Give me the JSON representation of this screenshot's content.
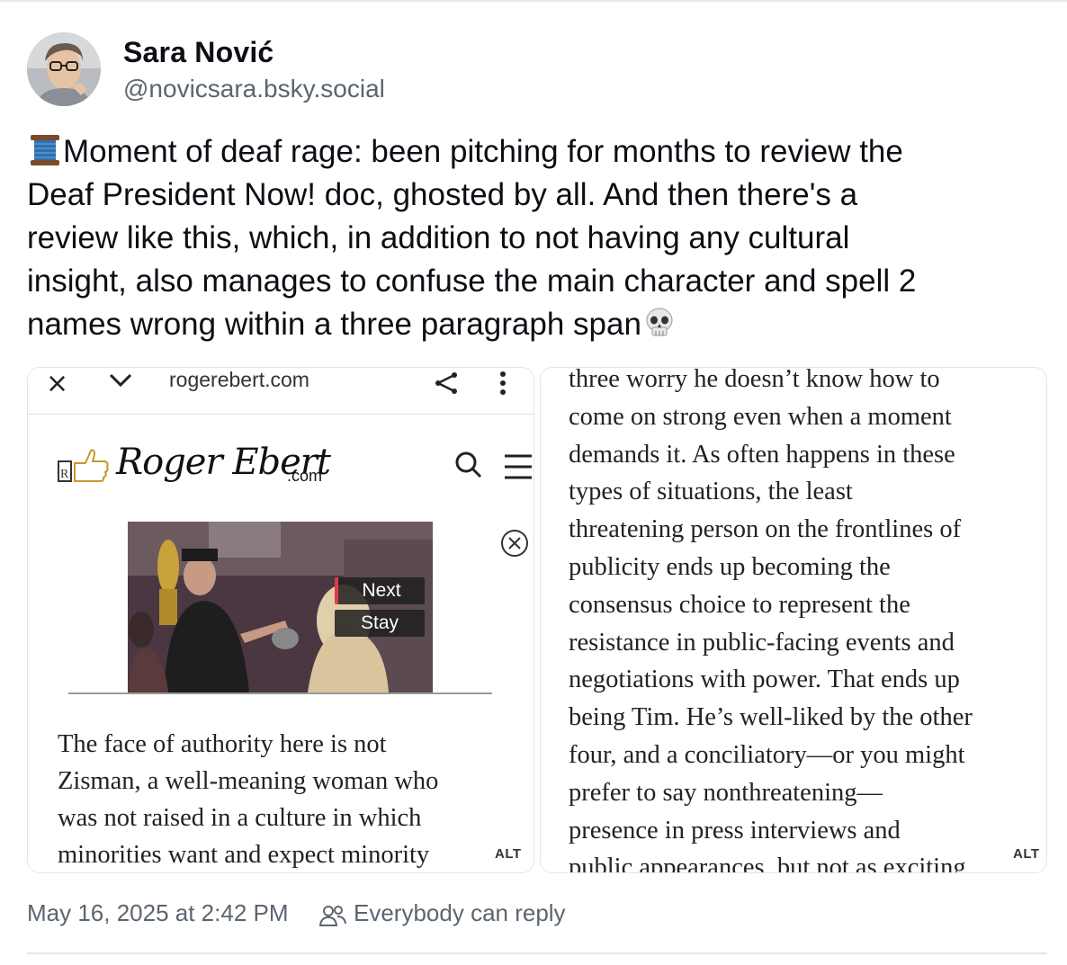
{
  "author": {
    "display_name": "Sara Nović",
    "handle": "@novicsara.bsky.social",
    "avatar_icon": "avatar"
  },
  "post": {
    "lines": [
      "Moment of deaf rage: been pitching for months to review the",
      "Deaf President Now! doc, ghosted by all. And then there's a",
      "review like this, which, in addition to not having any cultural",
      "insight, also manages to confuse the main character and spell 2",
      "names wrong within a three paragraph span"
    ],
    "lead_emoji": "spool-of-thread-icon",
    "trail_emoji": "skull-icon"
  },
  "images": {
    "left": {
      "browser": {
        "close_glyph": "×",
        "url": "rogerebert.com"
      },
      "site": {
        "logo_script": "Roger Ebert",
        "logo_com": ".com"
      },
      "video": {
        "next_label": "Next",
        "stay_label": "Stay"
      },
      "article_lines": [
        "The face of authority here is not",
        "Zisman, a well-meaning woman who",
        "was not raised in a culture in which",
        "minorities want and expect minority"
      ],
      "alt_label": "ALT"
    },
    "right": {
      "article_lines": [
        "three worry he doesn’t know how to",
        "come on strong even when a moment",
        "demands it. As often happens in these",
        "types of situations, the least",
        "threatening person on the frontlines of",
        "publicity ends up becoming the",
        "consensus choice to represent the",
        "resistance in public-facing events and",
        "negotiations with power. That ends up",
        "being Tim. He’s well-liked by the other",
        "four, and a conciliatory—or you might",
        "prefer to say nonthreatening—",
        "presence in press interviews and",
        "public appearances, but not as exciting"
      ],
      "alt_label": "ALT"
    }
  },
  "footer": {
    "timestamp": "May 16, 2025 at 2:42 PM",
    "reply_setting": "Everybody can reply"
  },
  "colors": {
    "text": "#0b0f14",
    "muted": "#5b6570",
    "border": "#e3e6ea"
  }
}
